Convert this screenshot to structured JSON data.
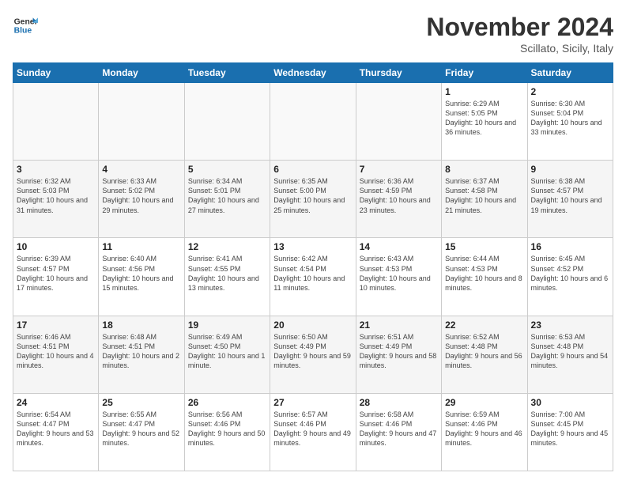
{
  "logo": {
    "line1": "General",
    "line2": "Blue"
  },
  "title": "November 2024",
  "location": "Scillato, Sicily, Italy",
  "days_of_week": [
    "Sunday",
    "Monday",
    "Tuesday",
    "Wednesday",
    "Thursday",
    "Friday",
    "Saturday"
  ],
  "weeks": [
    [
      {
        "day": "",
        "info": ""
      },
      {
        "day": "",
        "info": ""
      },
      {
        "day": "",
        "info": ""
      },
      {
        "day": "",
        "info": ""
      },
      {
        "day": "",
        "info": ""
      },
      {
        "day": "1",
        "info": "Sunrise: 6:29 AM\nSunset: 5:05 PM\nDaylight: 10 hours and 36 minutes."
      },
      {
        "day": "2",
        "info": "Sunrise: 6:30 AM\nSunset: 5:04 PM\nDaylight: 10 hours and 33 minutes."
      }
    ],
    [
      {
        "day": "3",
        "info": "Sunrise: 6:32 AM\nSunset: 5:03 PM\nDaylight: 10 hours and 31 minutes."
      },
      {
        "day": "4",
        "info": "Sunrise: 6:33 AM\nSunset: 5:02 PM\nDaylight: 10 hours and 29 minutes."
      },
      {
        "day": "5",
        "info": "Sunrise: 6:34 AM\nSunset: 5:01 PM\nDaylight: 10 hours and 27 minutes."
      },
      {
        "day": "6",
        "info": "Sunrise: 6:35 AM\nSunset: 5:00 PM\nDaylight: 10 hours and 25 minutes."
      },
      {
        "day": "7",
        "info": "Sunrise: 6:36 AM\nSunset: 4:59 PM\nDaylight: 10 hours and 23 minutes."
      },
      {
        "day": "8",
        "info": "Sunrise: 6:37 AM\nSunset: 4:58 PM\nDaylight: 10 hours and 21 minutes."
      },
      {
        "day": "9",
        "info": "Sunrise: 6:38 AM\nSunset: 4:57 PM\nDaylight: 10 hours and 19 minutes."
      }
    ],
    [
      {
        "day": "10",
        "info": "Sunrise: 6:39 AM\nSunset: 4:57 PM\nDaylight: 10 hours and 17 minutes."
      },
      {
        "day": "11",
        "info": "Sunrise: 6:40 AM\nSunset: 4:56 PM\nDaylight: 10 hours and 15 minutes."
      },
      {
        "day": "12",
        "info": "Sunrise: 6:41 AM\nSunset: 4:55 PM\nDaylight: 10 hours and 13 minutes."
      },
      {
        "day": "13",
        "info": "Sunrise: 6:42 AM\nSunset: 4:54 PM\nDaylight: 10 hours and 11 minutes."
      },
      {
        "day": "14",
        "info": "Sunrise: 6:43 AM\nSunset: 4:53 PM\nDaylight: 10 hours and 10 minutes."
      },
      {
        "day": "15",
        "info": "Sunrise: 6:44 AM\nSunset: 4:53 PM\nDaylight: 10 hours and 8 minutes."
      },
      {
        "day": "16",
        "info": "Sunrise: 6:45 AM\nSunset: 4:52 PM\nDaylight: 10 hours and 6 minutes."
      }
    ],
    [
      {
        "day": "17",
        "info": "Sunrise: 6:46 AM\nSunset: 4:51 PM\nDaylight: 10 hours and 4 minutes."
      },
      {
        "day": "18",
        "info": "Sunrise: 6:48 AM\nSunset: 4:51 PM\nDaylight: 10 hours and 2 minutes."
      },
      {
        "day": "19",
        "info": "Sunrise: 6:49 AM\nSunset: 4:50 PM\nDaylight: 10 hours and 1 minute."
      },
      {
        "day": "20",
        "info": "Sunrise: 6:50 AM\nSunset: 4:49 PM\nDaylight: 9 hours and 59 minutes."
      },
      {
        "day": "21",
        "info": "Sunrise: 6:51 AM\nSunset: 4:49 PM\nDaylight: 9 hours and 58 minutes."
      },
      {
        "day": "22",
        "info": "Sunrise: 6:52 AM\nSunset: 4:48 PM\nDaylight: 9 hours and 56 minutes."
      },
      {
        "day": "23",
        "info": "Sunrise: 6:53 AM\nSunset: 4:48 PM\nDaylight: 9 hours and 54 minutes."
      }
    ],
    [
      {
        "day": "24",
        "info": "Sunrise: 6:54 AM\nSunset: 4:47 PM\nDaylight: 9 hours and 53 minutes."
      },
      {
        "day": "25",
        "info": "Sunrise: 6:55 AM\nSunset: 4:47 PM\nDaylight: 9 hours and 52 minutes."
      },
      {
        "day": "26",
        "info": "Sunrise: 6:56 AM\nSunset: 4:46 PM\nDaylight: 9 hours and 50 minutes."
      },
      {
        "day": "27",
        "info": "Sunrise: 6:57 AM\nSunset: 4:46 PM\nDaylight: 9 hours and 49 minutes."
      },
      {
        "day": "28",
        "info": "Sunrise: 6:58 AM\nSunset: 4:46 PM\nDaylight: 9 hours and 47 minutes."
      },
      {
        "day": "29",
        "info": "Sunrise: 6:59 AM\nSunset: 4:46 PM\nDaylight: 9 hours and 46 minutes."
      },
      {
        "day": "30",
        "info": "Sunrise: 7:00 AM\nSunset: 4:45 PM\nDaylight: 9 hours and 45 minutes."
      }
    ]
  ]
}
